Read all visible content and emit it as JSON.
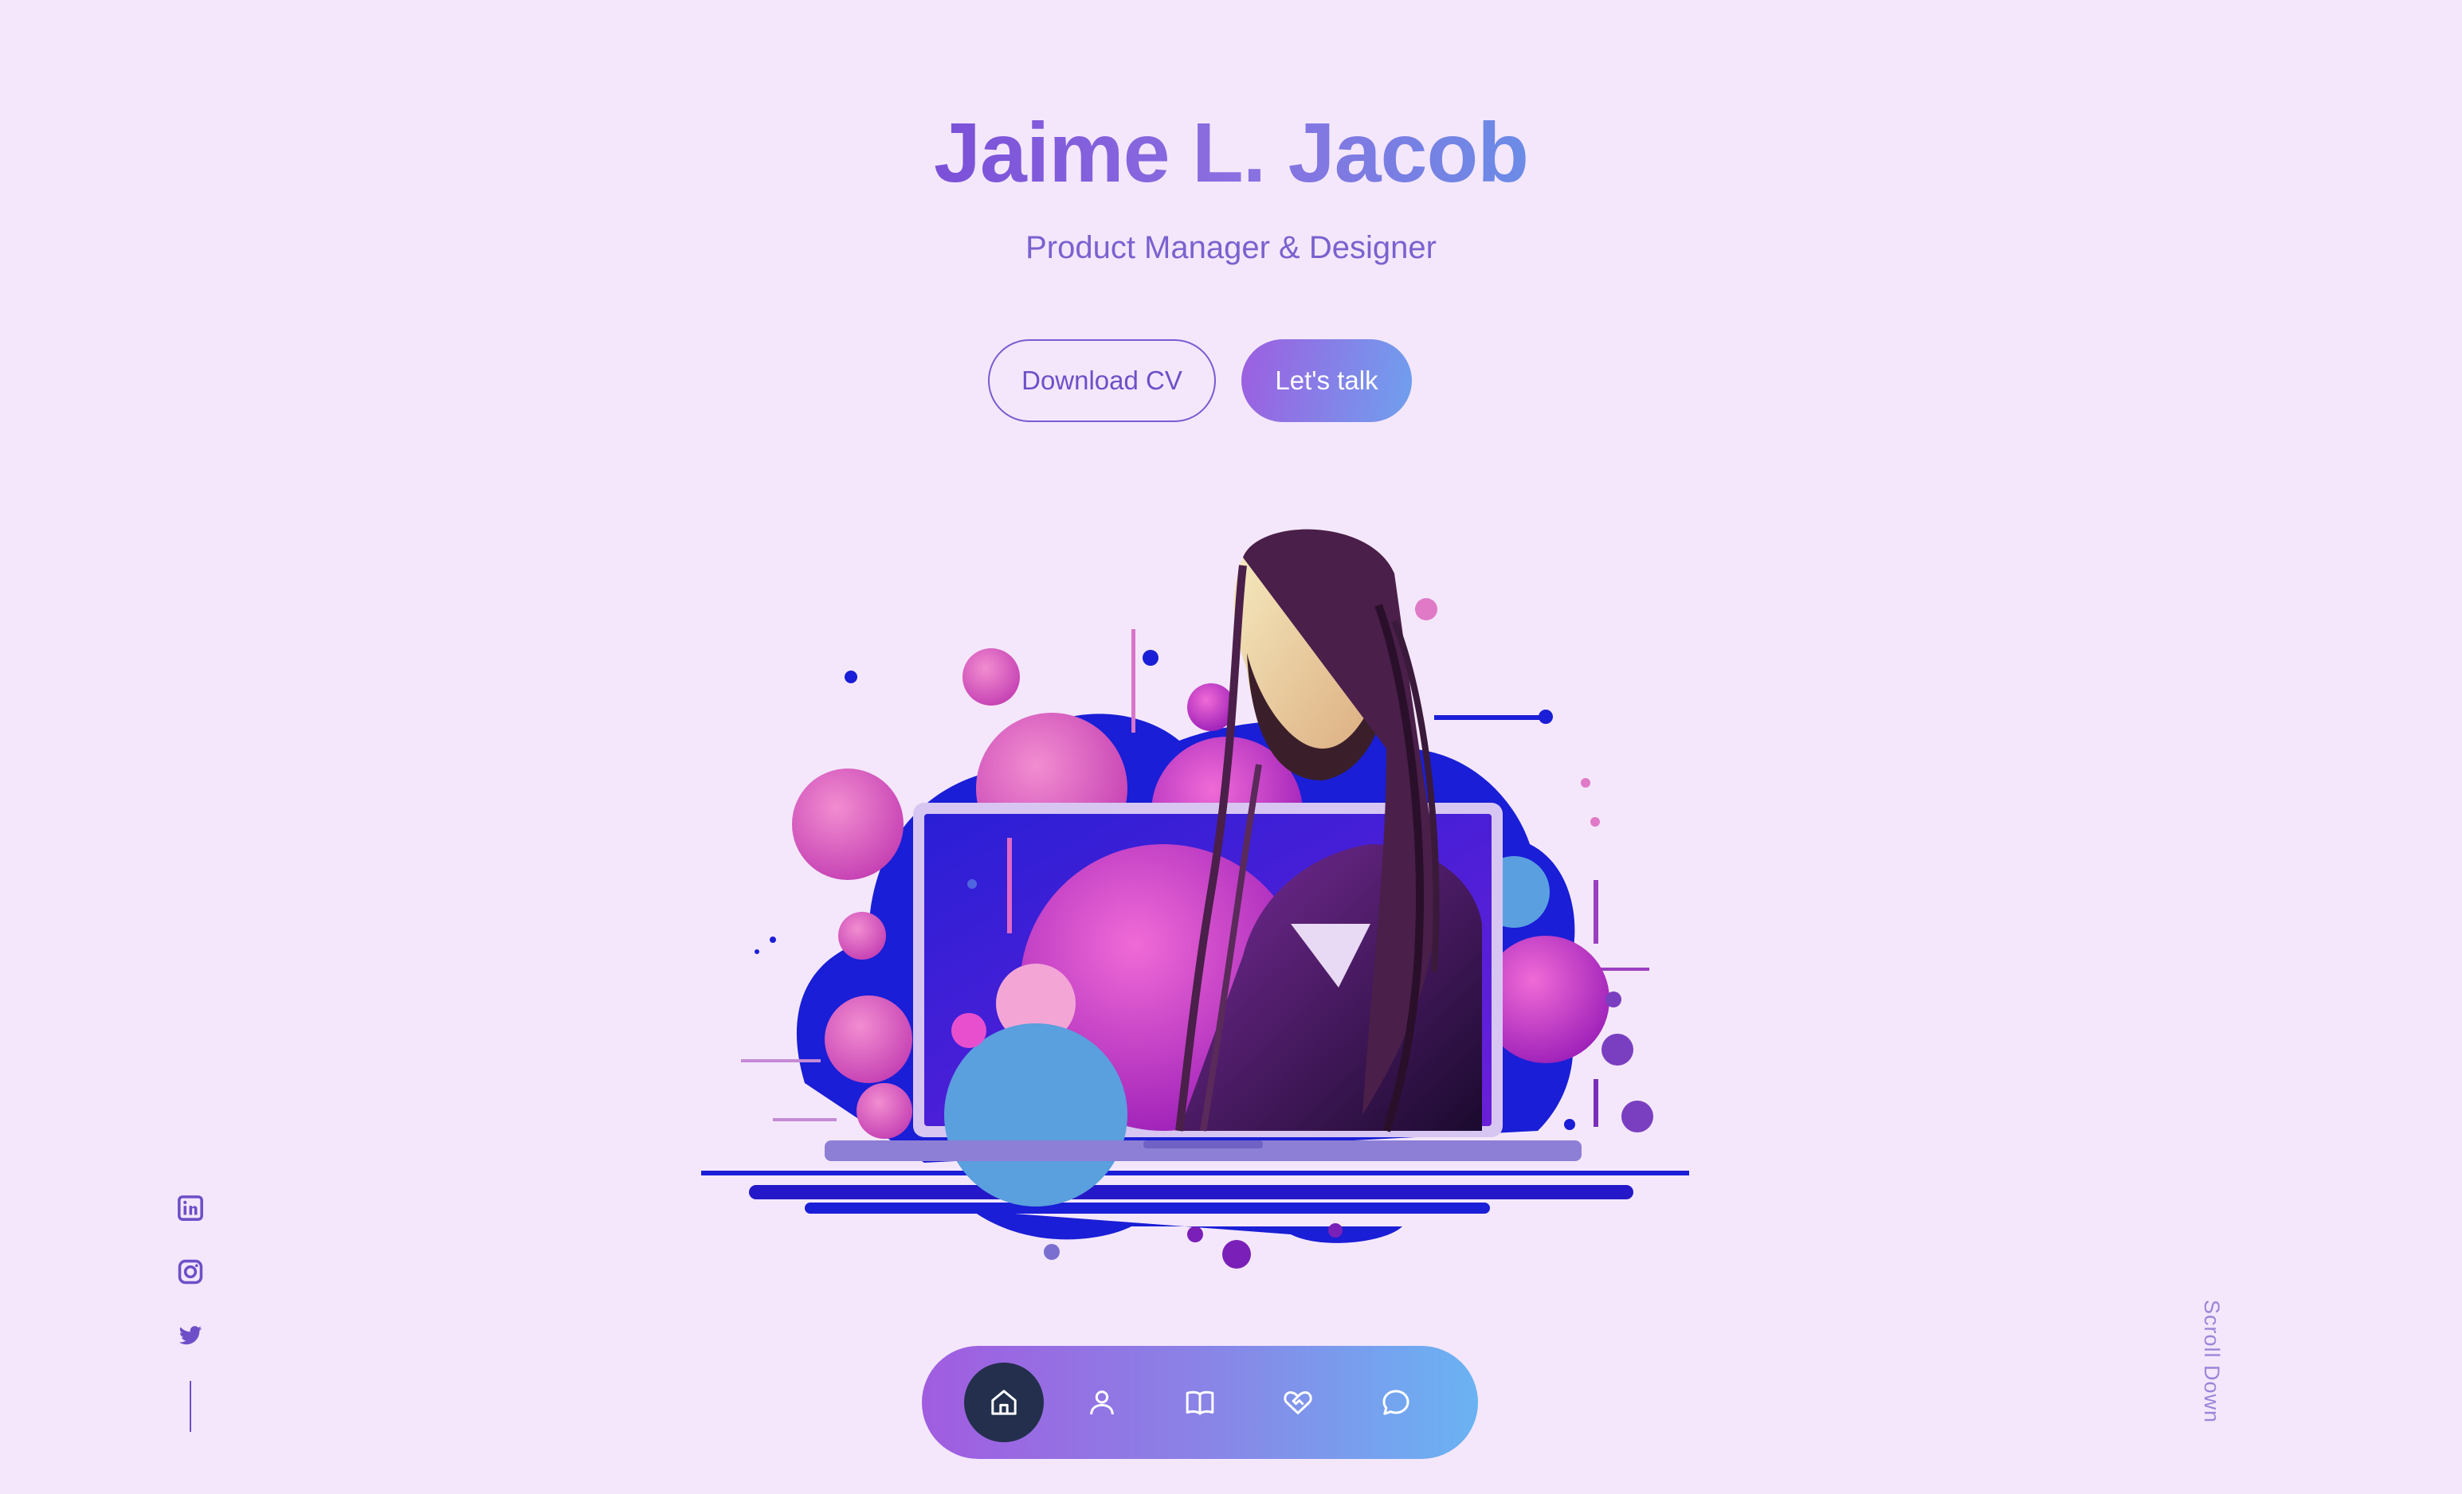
{
  "header": {
    "name": "Jaime L. Jacob",
    "role": "Product Manager & Designer"
  },
  "actions": {
    "download_label": "Download CV",
    "talk_label": "Let's talk"
  },
  "hero": {
    "image": "portrait-with-laptop-illustration"
  },
  "social": [
    {
      "icon": "linkedin-icon"
    },
    {
      "icon": "instagram-icon"
    },
    {
      "icon": "twitter-icon"
    }
  ],
  "scroll": {
    "label": "Scroll Down"
  },
  "nav": {
    "items": [
      {
        "icon": "home-icon",
        "active": true
      },
      {
        "icon": "user-icon",
        "active": false
      },
      {
        "icon": "book-icon",
        "active": false
      },
      {
        "icon": "heart-handshake-icon",
        "active": false
      },
      {
        "icon": "chat-icon",
        "active": false
      }
    ]
  },
  "colors": {
    "background": "#f4e7fb",
    "accent": "#7b4fd8",
    "gradient_start": "#a15ce0",
    "gradient_end": "#6ab3f3",
    "active_nav": "#232f4d"
  }
}
